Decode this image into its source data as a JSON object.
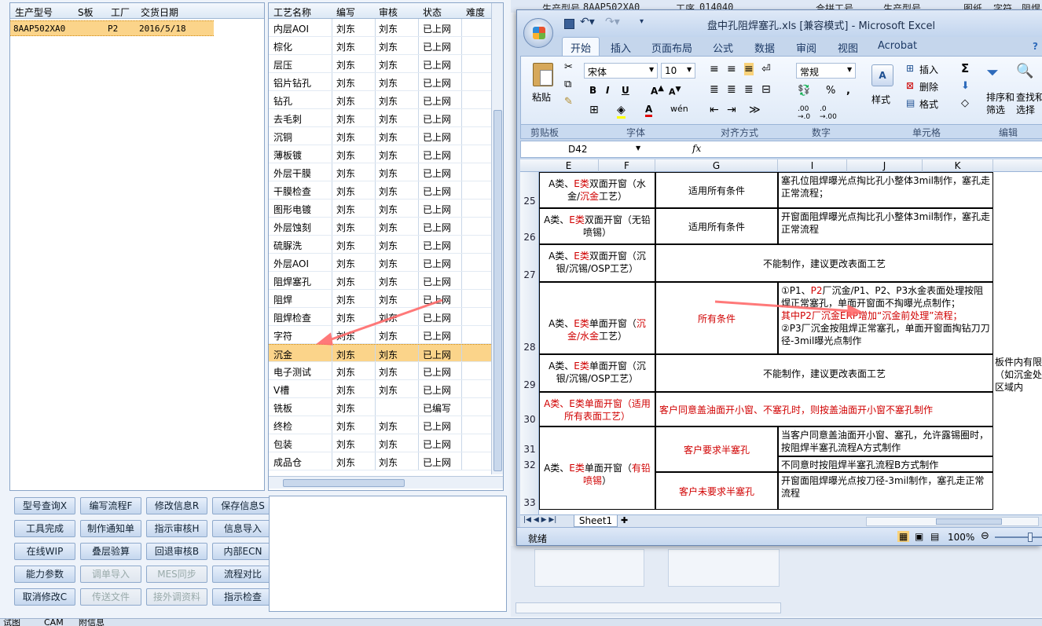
{
  "order_grid": {
    "headers": [
      "生产型号",
      "S板",
      "工厂",
      "交货日期"
    ],
    "rows": [
      [
        "8AAP502XA0",
        "",
        "P2",
        "2016/5/18"
      ]
    ]
  },
  "process_grid": {
    "headers": [
      "工艺名称",
      "编写",
      "审核",
      "状态",
      "难度"
    ],
    "rows": [
      [
        "内层AOI",
        "刘东",
        "刘东",
        "已上网"
      ],
      [
        "棕化",
        "刘东",
        "刘东",
        "已上网"
      ],
      [
        "层压",
        "刘东",
        "刘东",
        "已上网"
      ],
      [
        "铝片钻孔",
        "刘东",
        "刘东",
        "已上网"
      ],
      [
        "钻孔",
        "刘东",
        "刘东",
        "已上网"
      ],
      [
        "去毛刺",
        "刘东",
        "刘东",
        "已上网"
      ],
      [
        "沉铜",
        "刘东",
        "刘东",
        "已上网"
      ],
      [
        "薄板镀",
        "刘东",
        "刘东",
        "已上网"
      ],
      [
        "外层干膜",
        "刘东",
        "刘东",
        "已上网"
      ],
      [
        "干膜检查",
        "刘东",
        "刘东",
        "已上网"
      ],
      [
        "图形电镀",
        "刘东",
        "刘东",
        "已上网"
      ],
      [
        "外层蚀刻",
        "刘东",
        "刘东",
        "已上网"
      ],
      [
        "硫脲洗",
        "刘东",
        "刘东",
        "已上网"
      ],
      [
        "外层AOI",
        "刘东",
        "刘东",
        "已上网"
      ],
      [
        "阻焊塞孔",
        "刘东",
        "刘东",
        "已上网"
      ],
      [
        "阻焊",
        "刘东",
        "刘东",
        "已上网"
      ],
      [
        "阻焊检查",
        "刘东",
        "刘东",
        "已上网"
      ],
      [
        "字符",
        "刘东",
        "刘东",
        "已上网"
      ],
      [
        "沉金",
        "刘东",
        "刘东",
        "已上网"
      ],
      [
        "电子测试",
        "刘东",
        "刘东",
        "已上网"
      ],
      [
        "V槽",
        "刘东",
        "刘东",
        "已上网"
      ],
      [
        "铣板",
        "刘东",
        "",
        "已编写"
      ],
      [
        "终检",
        "刘东",
        "刘东",
        "已上网"
      ],
      [
        "包装",
        "刘东",
        "刘东",
        "已上网"
      ],
      [
        "成品仓",
        "刘东",
        "刘东",
        "已上网"
      ]
    ],
    "selected": "沉金"
  },
  "buttons": [
    [
      "型号查询X",
      "编写流程F",
      "修改信息R",
      "保存信息S"
    ],
    [
      "工具完成",
      "制作通知单",
      "指示审核H",
      "信息导入"
    ],
    [
      "在线WIP",
      "叠层验算",
      "回退审核B",
      "内部ECN"
    ],
    [
      "能力参数",
      "调单导入",
      "MES同步",
      "流程对比"
    ],
    [
      "取消修改C",
      "传送文件",
      "接外调资料",
      "指示检查"
    ]
  ],
  "disabled_buttons": [
    "调单导入",
    "MES同步",
    "传送文件",
    "接外调资料"
  ],
  "bottom_tabs": [
    "试图",
    "CAM",
    "附信息"
  ],
  "behind_header": {
    "l1": "生产型号",
    "v1": "8AAP502XA0",
    "l2": "工序",
    "v2": "014040",
    "l3": "合拼工号",
    "l4": "生产型号",
    "l5": "图纸",
    "l6": "字符",
    "l7": "阻焊"
  },
  "excel": {
    "title": "盘中孔阻焊塞孔.xls  [兼容模式] - Microsoft Excel",
    "ribbon_tabs": [
      "开始",
      "插入",
      "页面布局",
      "公式",
      "数据",
      "审阅",
      "视图",
      "Acrobat"
    ],
    "active_tab": "开始",
    "font_name": "宋体",
    "font_size": "10",
    "number_format": "常规",
    "name_box": "D42",
    "fx": "fx",
    "groups": [
      "剪贴板",
      "字体",
      "对齐方式",
      "数字",
      "单元格",
      "编辑"
    ],
    "clipboard": {
      "paste": "粘贴"
    },
    "styles_label": "样式",
    "cells_items": [
      "插入",
      "删除",
      "格式"
    ],
    "edit_items": [
      "排序和筛选",
      "查找和选择"
    ],
    "columns": [
      "E",
      "F",
      "G",
      "I",
      "J",
      "K"
    ],
    "rows": [
      {
        "n": "25",
        "a": [
          "A类、",
          "E类",
          "双面开窗（水金/",
          "沉金",
          "工艺）"
        ],
        "cond": "适用所有条件",
        "proc": "塞孔位阻焊曝光点掏比孔小整体3mil制作，塞孔走正常流程；"
      },
      {
        "n": "26",
        "a": [
          "A类、",
          "E类",
          "双面开窗（无铅喷锡）"
        ],
        "cond": "适用所有条件",
        "proc": "开窗面阻焊曝光点掏比孔小整体3mil制作，塞孔走正常流程"
      },
      {
        "n": "27",
        "a": [
          "A类、",
          "E类",
          "双面开窗（沉银/沉锡/OSP工艺）"
        ],
        "merged": "不能制作，建议更改表面工艺"
      },
      {
        "n": "28",
        "a": [
          "A类、",
          "E类",
          "单面开窗（",
          "沉金/水金",
          "工艺）"
        ],
        "cond": "所有条件",
        "proc_lines": [
          "①P1、",
          "P2",
          "厂沉金/P1、P2、P3水金表面处理按阻焊正常塞孔，单面开窗面不掏曝光点制作；",
          "其中P2厂沉金ERP增加“沉金前处理”流程；",
          "②P3厂沉金按阻焊正常塞孔，单面开窗面掏钻刀刀径-3mil曝光点制作"
        ]
      },
      {
        "n": "29",
        "a": [
          "A类、",
          "E类",
          "单面开窗（沉银/沉锡/OSP工艺）"
        ],
        "merged": "不能制作，建议更改表面工艺",
        "side": "板件内有限（如沉金处理区域内"
      },
      {
        "n": "30",
        "a_red": "A类、E类单面开窗（适用所有表面工艺）",
        "merged_red": "客户同意盖油面开小窗、不塞孔时，则按盖油面开小窗不塞孔制作"
      },
      {
        "n": "31",
        "a": [
          "A类、",
          "E类",
          "单面开窗（",
          "有铅喷锡",
          "）"
        ],
        "cond_red": "客户要求半塞孔",
        "proc": "当客户同意盖油面开小窗、塞孔，允许露锡圈时，按阻焊半塞孔流程A方式制作"
      },
      {
        "n": "32",
        "proc": "不同意时按阻焊半塞孔流程B方式制作"
      },
      {
        "n": "33",
        "cond_red": "客户未要求半塞孔",
        "proc": "开窗面阻焊曝光点按刀径-3mil制作，塞孔走正常流程"
      }
    ],
    "sheet_tab": "Sheet1",
    "status": "就绪",
    "zoom": "100%",
    "accent": "#1d4f91"
  }
}
